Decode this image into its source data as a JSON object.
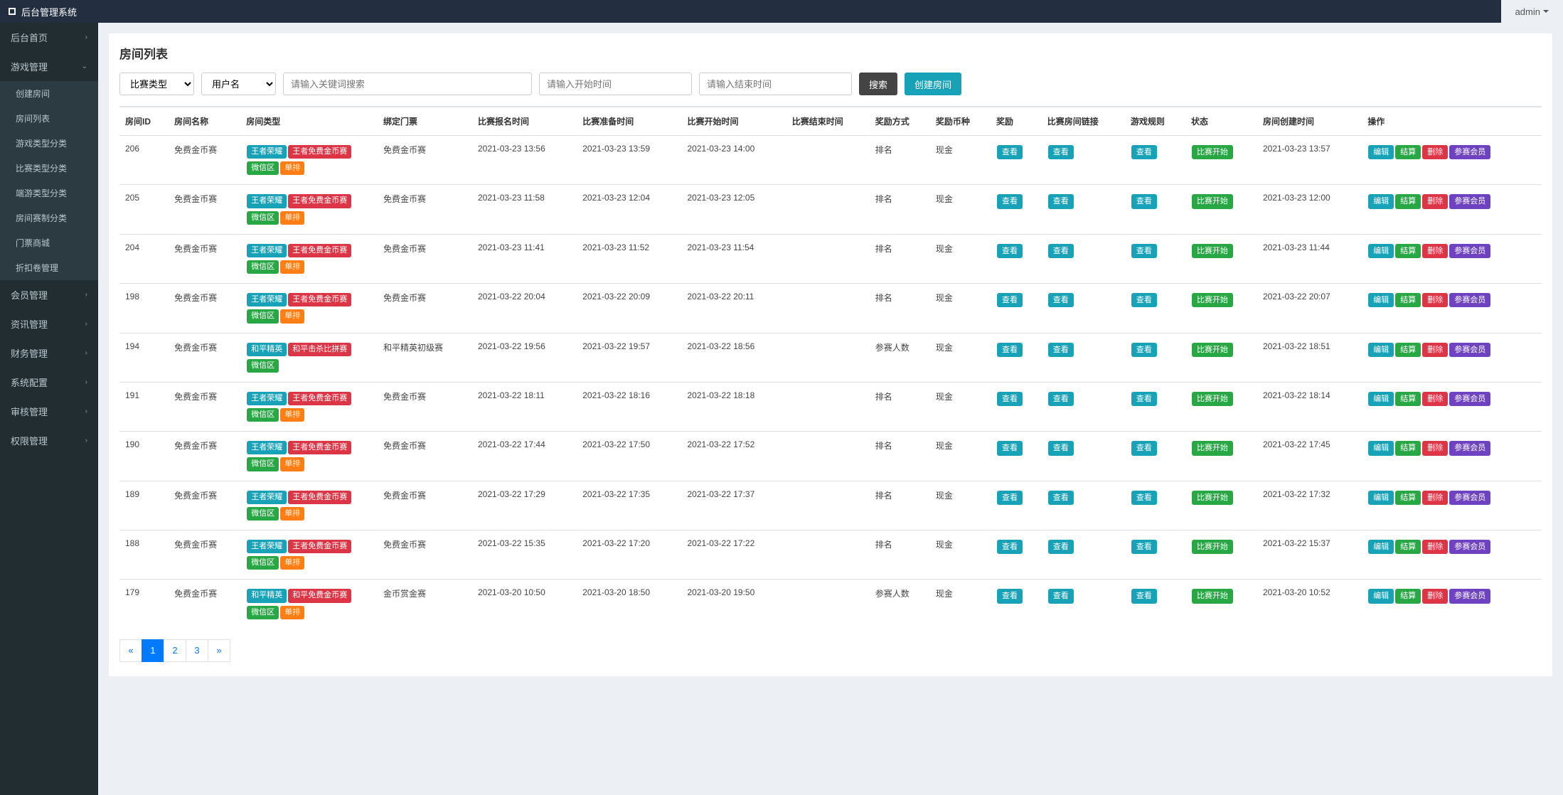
{
  "brand": "后台管理系统",
  "user": "admin",
  "sidebar": {
    "items": [
      {
        "label": "后台首页",
        "arrow": "›",
        "sub": []
      },
      {
        "label": "游戏管理",
        "arrow": "⌄",
        "sub": [
          {
            "label": "创建房间"
          },
          {
            "label": "房间列表"
          },
          {
            "label": "游戏类型分类"
          },
          {
            "label": "比赛类型分类"
          },
          {
            "label": "端游类型分类"
          },
          {
            "label": "房间赛制分类"
          },
          {
            "label": "门票商城"
          },
          {
            "label": "折扣卷管理"
          }
        ]
      },
      {
        "label": "会员管理",
        "arrow": "›",
        "sub": []
      },
      {
        "label": "资讯管理",
        "arrow": "›",
        "sub": []
      },
      {
        "label": "财务管理",
        "arrow": "›",
        "sub": []
      },
      {
        "label": "系统配置",
        "arrow": "›",
        "sub": []
      },
      {
        "label": "审核管理",
        "arrow": "›",
        "sub": []
      },
      {
        "label": "权限管理",
        "arrow": "›",
        "sub": []
      }
    ]
  },
  "page": {
    "title": "房间列表",
    "filter_type": "比赛类型",
    "filter_user": "用户名",
    "ph_keyword": "请输入关键词搜索",
    "ph_start": "请输入开始时间",
    "ph_end": "请输入结束时间",
    "btn_search": "搜索",
    "btn_create": "创建房间"
  },
  "columns": [
    "房间ID",
    "房间名称",
    "房间类型",
    "绑定门票",
    "比赛报名时间",
    "比赛准备时间",
    "比赛开始时间",
    "比赛结束时间",
    "奖励方式",
    "奖励币种",
    "奖励",
    "比赛房间链接",
    "游戏规则",
    "状态",
    "房间创建时间",
    "操作"
  ],
  "action_labels": {
    "view": "查看",
    "status": "比赛开始",
    "edit": "编辑",
    "settle": "结算",
    "delete": "删除",
    "member": "参赛会员"
  },
  "rows": [
    {
      "id": "206",
      "name": "免费金币赛",
      "tags": [
        {
          "t": "王者荣耀",
          "c": "cyan"
        },
        {
          "t": "王者免费金币赛",
          "c": "red"
        },
        {
          "t": "微信区",
          "c": "green"
        },
        {
          "t": "单排",
          "c": "orange"
        }
      ],
      "ticket": "免费金币赛",
      "t1": "2021-03-23 13:56",
      "t2": "2021-03-23 13:59",
      "t3": "2021-03-23 14:00",
      "t4": "",
      "reward": "排名",
      "coin": "现金",
      "created": "2021-03-23 13:57"
    },
    {
      "id": "205",
      "name": "免费金币赛",
      "tags": [
        {
          "t": "王者荣耀",
          "c": "cyan"
        },
        {
          "t": "王者免费金币赛",
          "c": "red"
        },
        {
          "t": "微信区",
          "c": "green"
        },
        {
          "t": "单排",
          "c": "orange"
        }
      ],
      "ticket": "免费金币赛",
      "t1": "2021-03-23 11:58",
      "t2": "2021-03-23 12:04",
      "t3": "2021-03-23 12:05",
      "t4": "",
      "reward": "排名",
      "coin": "现金",
      "created": "2021-03-23 12:00"
    },
    {
      "id": "204",
      "name": "免费金币赛",
      "tags": [
        {
          "t": "王者荣耀",
          "c": "cyan"
        },
        {
          "t": "王者免费金币赛",
          "c": "red"
        },
        {
          "t": "微信区",
          "c": "green"
        },
        {
          "t": "单排",
          "c": "orange"
        }
      ],
      "ticket": "免费金币赛",
      "t1": "2021-03-23 11:41",
      "t2": "2021-03-23 11:52",
      "t3": "2021-03-23 11:54",
      "t4": "",
      "reward": "排名",
      "coin": "现金",
      "created": "2021-03-23 11:44"
    },
    {
      "id": "198",
      "name": "免费金币赛",
      "tags": [
        {
          "t": "王者荣耀",
          "c": "cyan"
        },
        {
          "t": "王者免费金币赛",
          "c": "red"
        },
        {
          "t": "微信区",
          "c": "green"
        },
        {
          "t": "单排",
          "c": "orange"
        }
      ],
      "ticket": "免费金币赛",
      "t1": "2021-03-22 20:04",
      "t2": "2021-03-22 20:09",
      "t3": "2021-03-22 20:11",
      "t4": "",
      "reward": "排名",
      "coin": "现金",
      "created": "2021-03-22 20:07"
    },
    {
      "id": "194",
      "name": "免费金币赛",
      "tags": [
        {
          "t": "和平精英",
          "c": "cyan"
        },
        {
          "t": "和平击杀比拼赛",
          "c": "red"
        },
        {
          "t": "微信区",
          "c": "green"
        }
      ],
      "ticket": "和平精英初级赛",
      "t1": "2021-03-22 19:56",
      "t2": "2021-03-22 19:57",
      "t3": "2021-03-22 18:56",
      "t4": "",
      "reward": "参赛人数",
      "coin": "现金",
      "created": "2021-03-22 18:51"
    },
    {
      "id": "191",
      "name": "免费金币赛",
      "tags": [
        {
          "t": "王者荣耀",
          "c": "cyan"
        },
        {
          "t": "王者免费金币赛",
          "c": "red"
        },
        {
          "t": "微信区",
          "c": "green"
        },
        {
          "t": "单排",
          "c": "orange"
        }
      ],
      "ticket": "免费金币赛",
      "t1": "2021-03-22 18:11",
      "t2": "2021-03-22 18:16",
      "t3": "2021-03-22 18:18",
      "t4": "",
      "reward": "排名",
      "coin": "现金",
      "created": "2021-03-22 18:14"
    },
    {
      "id": "190",
      "name": "免费金币赛",
      "tags": [
        {
          "t": "王者荣耀",
          "c": "cyan"
        },
        {
          "t": "王者免费金币赛",
          "c": "red"
        },
        {
          "t": "微信区",
          "c": "green"
        },
        {
          "t": "单排",
          "c": "orange"
        }
      ],
      "ticket": "免费金币赛",
      "t1": "2021-03-22 17:44",
      "t2": "2021-03-22 17:50",
      "t3": "2021-03-22 17:52",
      "t4": "",
      "reward": "排名",
      "coin": "现金",
      "created": "2021-03-22 17:45"
    },
    {
      "id": "189",
      "name": "免费金币赛",
      "tags": [
        {
          "t": "王者荣耀",
          "c": "cyan"
        },
        {
          "t": "王者免费金币赛",
          "c": "red"
        },
        {
          "t": "微信区",
          "c": "green"
        },
        {
          "t": "单排",
          "c": "orange"
        }
      ],
      "ticket": "免费金币赛",
      "t1": "2021-03-22 17:29",
      "t2": "2021-03-22 17:35",
      "t3": "2021-03-22 17:37",
      "t4": "",
      "reward": "排名",
      "coin": "现金",
      "created": "2021-03-22 17:32"
    },
    {
      "id": "188",
      "name": "免费金币赛",
      "tags": [
        {
          "t": "王者荣耀",
          "c": "cyan"
        },
        {
          "t": "王者免费金币赛",
          "c": "red"
        },
        {
          "t": "微信区",
          "c": "green"
        },
        {
          "t": "单排",
          "c": "orange"
        }
      ],
      "ticket": "免费金币赛",
      "t1": "2021-03-22 15:35",
      "t2": "2021-03-22 17:20",
      "t3": "2021-03-22 17:22",
      "t4": "",
      "reward": "排名",
      "coin": "现金",
      "created": "2021-03-22 15:37"
    },
    {
      "id": "179",
      "name": "免费金币赛",
      "tags": [
        {
          "t": "和平精英",
          "c": "cyan"
        },
        {
          "t": "和平免费金币赛",
          "c": "red"
        },
        {
          "t": "微信区",
          "c": "green"
        },
        {
          "t": "单排",
          "c": "orange"
        }
      ],
      "ticket": "金币赏金赛",
      "t1": "2021-03-20 10:50",
      "t2": "2021-03-20 18:50",
      "t3": "2021-03-20 19:50",
      "t4": "",
      "reward": "参赛人数",
      "coin": "现金",
      "created": "2021-03-20 10:52"
    }
  ],
  "pagination": [
    "«",
    "1",
    "2",
    "3",
    "»"
  ],
  "pagination_active": 1
}
